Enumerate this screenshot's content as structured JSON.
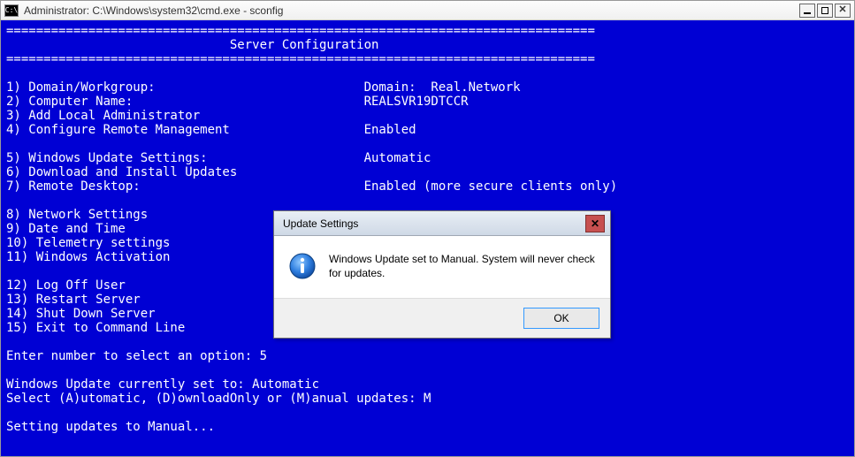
{
  "window": {
    "title": "Administrator: C:\\Windows\\system32\\cmd.exe - sconfig",
    "app_icon_label": "C:\\"
  },
  "console": {
    "rule": "===============================================================================",
    "header": "                              Server Configuration",
    "items": {
      "1": {
        "label": "1) Domain/Workgroup:",
        "value": "Domain:  Real.Network"
      },
      "2": {
        "label": "2) Computer Name:",
        "value": "REALSVR19DTCCR"
      },
      "3": {
        "label": "3) Add Local Administrator",
        "value": ""
      },
      "4": {
        "label": "4) Configure Remote Management",
        "value": "Enabled"
      },
      "5": {
        "label": "5) Windows Update Settings:",
        "value": "Automatic"
      },
      "6": {
        "label": "6) Download and Install Updates",
        "value": ""
      },
      "7": {
        "label": "7) Remote Desktop:",
        "value": "Enabled (more secure clients only)"
      },
      "8": {
        "label": "8) Network Settings",
        "value": ""
      },
      "9": {
        "label": "9) Date and Time",
        "value": ""
      },
      "10": {
        "label": "10) Telemetry settings",
        "value": ""
      },
      "11": {
        "label": "11) Windows Activation",
        "value": ""
      },
      "12": {
        "label": "12) Log Off User",
        "value": ""
      },
      "13": {
        "label": "13) Restart Server",
        "value": ""
      },
      "14": {
        "label": "14) Shut Down Server",
        "value": ""
      },
      "15": {
        "label": "15) Exit to Command Line",
        "value": ""
      }
    },
    "prompt_label": "Enter number to select an option: ",
    "prompt_input": "5",
    "status1": "Windows Update currently set to: Automatic",
    "mode_prompt_label": "Select (A)utomatic, (D)ownloadOnly or (M)anual updates: ",
    "mode_prompt_input": "M",
    "status2": "Setting updates to Manual..."
  },
  "dialog": {
    "title": "Update Settings",
    "message": "Windows Update set to Manual.  System will never check for updates.",
    "ok_label": "OK"
  }
}
